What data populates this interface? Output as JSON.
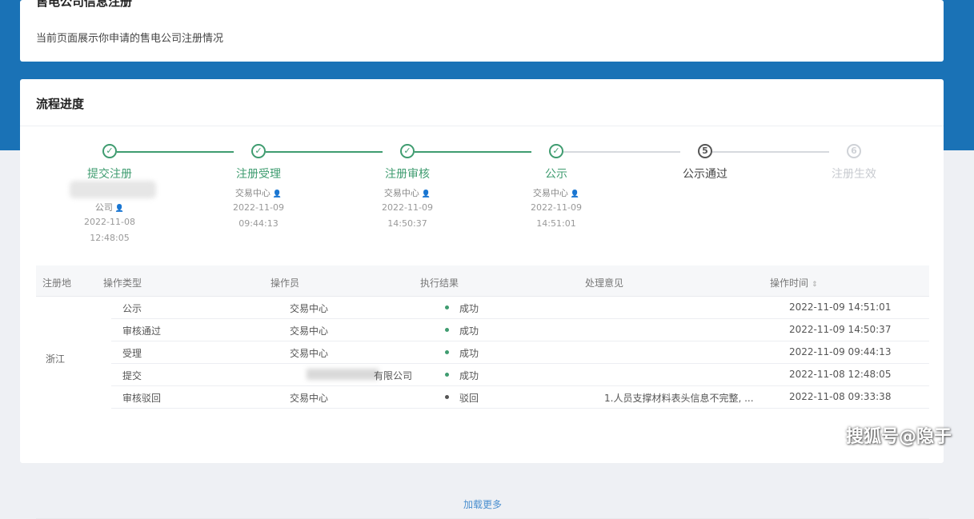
{
  "header": {
    "title": "售电公司信息注册",
    "subtitle": "当前页面展示你申请的售电公司注册情况"
  },
  "progress": {
    "title": "流程进度",
    "steps": [
      {
        "name": "提交注册",
        "operator": "公司",
        "date": "2022-11-08",
        "time": "12:48:05",
        "status": "done",
        "icon": "check-icon"
      },
      {
        "name": "注册受理",
        "operator": "交易中心",
        "date": "2022-11-09",
        "time": "09:44:13",
        "status": "done",
        "icon": "check-icon"
      },
      {
        "name": "注册审核",
        "operator": "交易中心",
        "date": "2022-11-09",
        "time": "14:50:37",
        "status": "done",
        "icon": "check-icon"
      },
      {
        "name": "公示",
        "operator": "交易中心",
        "date": "2022-11-09",
        "time": "14:51:01",
        "status": "done",
        "icon": "check-icon"
      },
      {
        "name": "公示通过",
        "number": "5",
        "status": "current"
      },
      {
        "name": "注册生效",
        "number": "6",
        "status": "pending"
      }
    ]
  },
  "table": {
    "columns": [
      "注册地",
      "操作类型",
      "操作员",
      "执行结果",
      "处理意见",
      "操作时间"
    ],
    "region": "浙江",
    "rows": [
      {
        "type": "公示",
        "operator": "交易中心",
        "result": "成功",
        "opinion": "",
        "time": "2022-11-09 14:51:01"
      },
      {
        "type": "审核通过",
        "operator": "交易中心",
        "result": "成功",
        "opinion": "",
        "time": "2022-11-09 14:50:37"
      },
      {
        "type": "受理",
        "operator": "交易中心",
        "result": "成功",
        "opinion": "",
        "time": "2022-11-09 09:44:13"
      },
      {
        "type": "提交",
        "operator": "有限公司",
        "result": "成功",
        "opinion": "",
        "time": "2022-11-08 12:48:05"
      },
      {
        "type": "审核驳回",
        "operator": "交易中心",
        "result": "驳回",
        "opinion": "1.人员支撑材料表头信息不完整, ...",
        "time": "2022-11-08 09:33:38"
      }
    ],
    "load_more": "加载更多"
  },
  "watermark": "搜狐号@隐于",
  "colors": {
    "brand_blue": "#1a72b6",
    "success_green": "#3f9c70",
    "link_blue": "#4a8fcf"
  }
}
